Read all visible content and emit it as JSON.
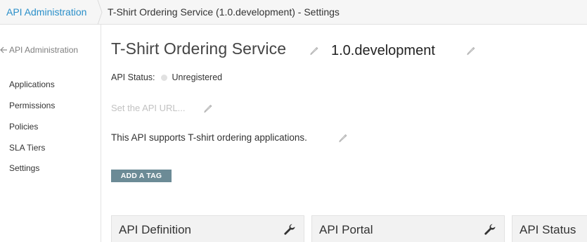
{
  "breadcrumb": {
    "root": "API Administration",
    "current": "T-Shirt Ordering Service (1.0.development) - Settings"
  },
  "sidebar": {
    "back_label": "API Administration",
    "items": [
      {
        "label": "Applications"
      },
      {
        "label": "Permissions"
      },
      {
        "label": "Policies"
      },
      {
        "label": "SLA Tiers"
      },
      {
        "label": "Settings"
      }
    ]
  },
  "api": {
    "name": "T-Shirt Ordering Service",
    "version": "1.0.development",
    "status_label": "API Status:",
    "status_value": "Unregistered",
    "url_placeholder": "Set the API URL...",
    "description": "This API supports T-shirt ordering applications.",
    "add_tag_label": "ADD A TAG"
  },
  "cards": [
    {
      "title": "API Definition",
      "icon": "wrench-icon"
    },
    {
      "title": "API Portal",
      "icon": "wrench-icon"
    },
    {
      "title": "API Status"
    }
  ],
  "colors": {
    "link": "#2a8fc9",
    "tag_button": "#6c8b96",
    "status_dot": "#e1e1e1"
  }
}
